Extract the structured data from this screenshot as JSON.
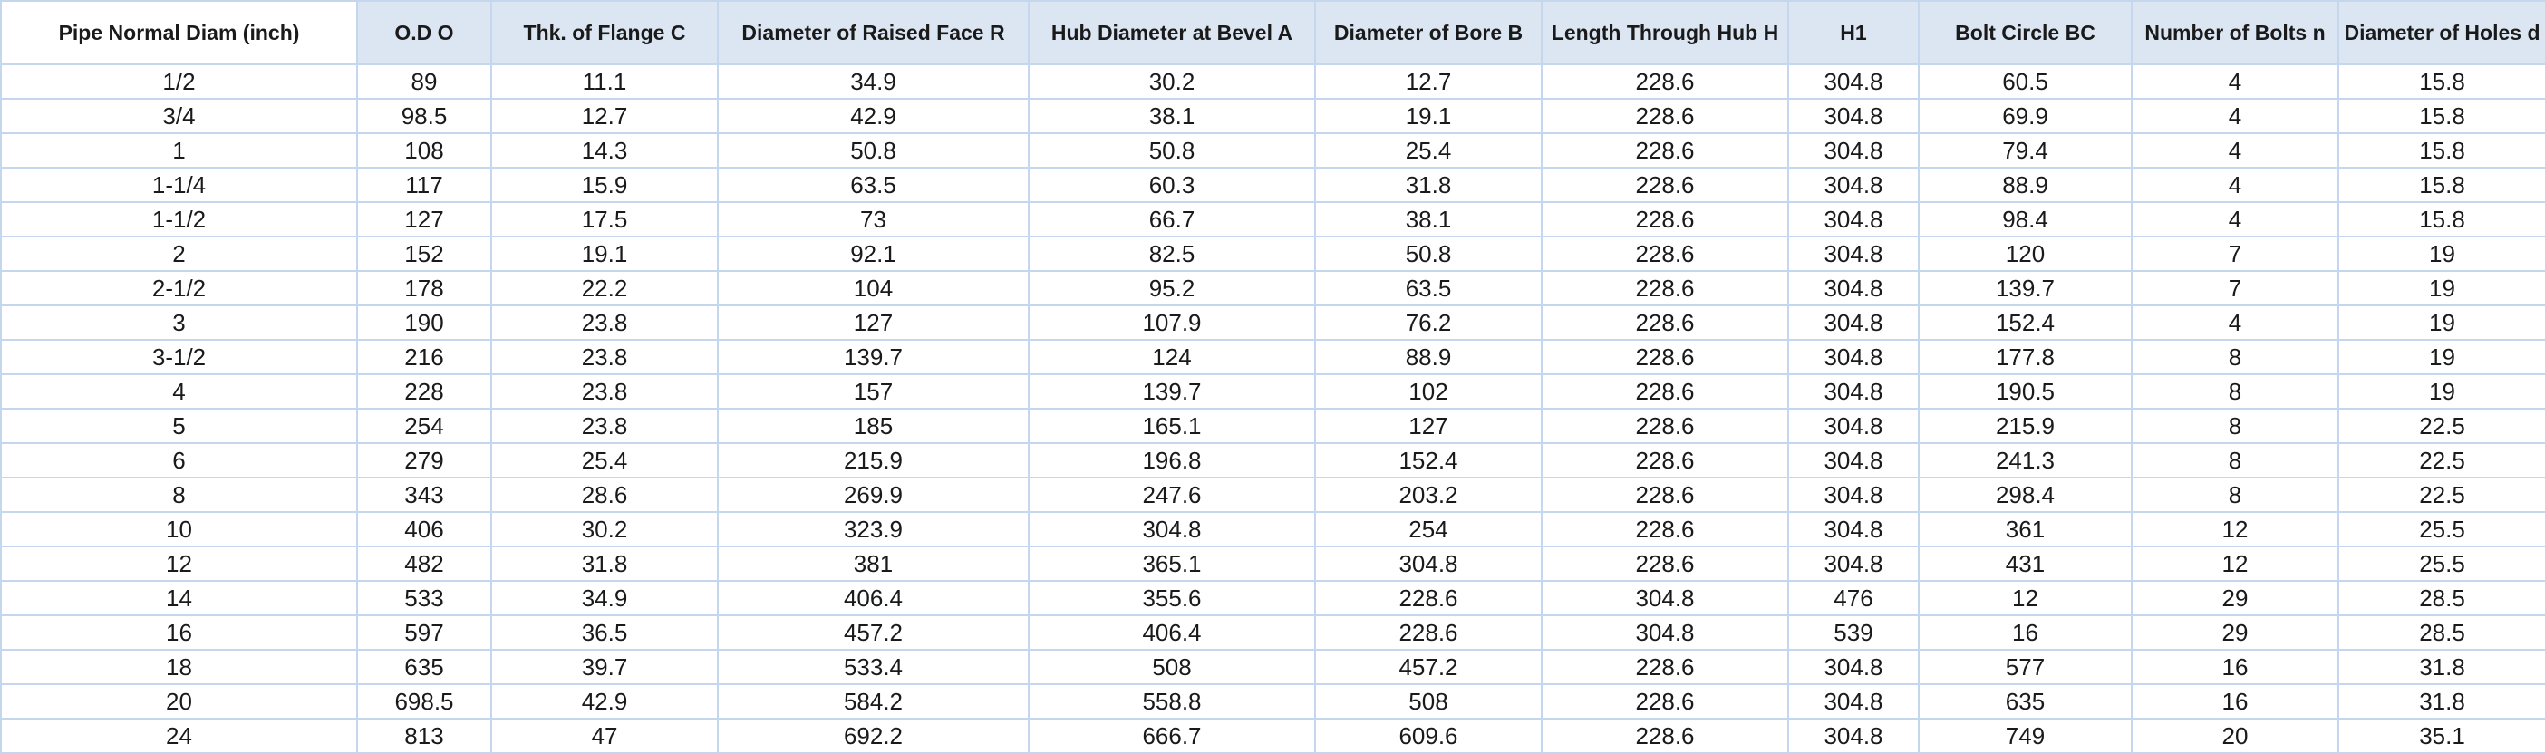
{
  "table": {
    "columns": [
      "Pipe Normal Diam (inch)",
      "O.D O",
      "Thk. of Flange C",
      "Diameter of Raised Face R",
      "Hub Diameter at Bevel A",
      "Diameter of Bore B",
      "Length Through Hub H",
      "H1",
      "Bolt Circle BC",
      "Number of Bolts n",
      "Diameter of Holes d"
    ],
    "rows": [
      [
        "1/2",
        "89",
        "11.1",
        "34.9",
        "30.2",
        "12.7",
        "228.6",
        "304.8",
        "60.5",
        "4",
        "15.8"
      ],
      [
        "3/4",
        "98.5",
        "12.7",
        "42.9",
        "38.1",
        "19.1",
        "228.6",
        "304.8",
        "69.9",
        "4",
        "15.8"
      ],
      [
        "1",
        "108",
        "14.3",
        "50.8",
        "50.8",
        "25.4",
        "228.6",
        "304.8",
        "79.4",
        "4",
        "15.8"
      ],
      [
        "1-1/4",
        "117",
        "15.9",
        "63.5",
        "60.3",
        "31.8",
        "228.6",
        "304.8",
        "88.9",
        "4",
        "15.8"
      ],
      [
        "1-1/2",
        "127",
        "17.5",
        "73",
        "66.7",
        "38.1",
        "228.6",
        "304.8",
        "98.4",
        "4",
        "15.8"
      ],
      [
        "2",
        "152",
        "19.1",
        "92.1",
        "82.5",
        "50.8",
        "228.6",
        "304.8",
        "120",
        "7",
        "19"
      ],
      [
        "2-1/2",
        "178",
        "22.2",
        "104",
        "95.2",
        "63.5",
        "228.6",
        "304.8",
        "139.7",
        "7",
        "19"
      ],
      [
        "3",
        "190",
        "23.8",
        "127",
        "107.9",
        "76.2",
        "228.6",
        "304.8",
        "152.4",
        "4",
        "19"
      ],
      [
        "3-1/2",
        "216",
        "23.8",
        "139.7",
        "124",
        "88.9",
        "228.6",
        "304.8",
        "177.8",
        "8",
        "19"
      ],
      [
        "4",
        "228",
        "23.8",
        "157",
        "139.7",
        "102",
        "228.6",
        "304.8",
        "190.5",
        "8",
        "19"
      ],
      [
        "5",
        "254",
        "23.8",
        "185",
        "165.1",
        "127",
        "228.6",
        "304.8",
        "215.9",
        "8",
        "22.5"
      ],
      [
        "6",
        "279",
        "25.4",
        "215.9",
        "196.8",
        "152.4",
        "228.6",
        "304.8",
        "241.3",
        "8",
        "22.5"
      ],
      [
        "8",
        "343",
        "28.6",
        "269.9",
        "247.6",
        "203.2",
        "228.6",
        "304.8",
        "298.4",
        "8",
        "22.5"
      ],
      [
        "10",
        "406",
        "30.2",
        "323.9",
        "304.8",
        "254",
        "228.6",
        "304.8",
        "361",
        "12",
        "25.5"
      ],
      [
        "12",
        "482",
        "31.8",
        "381",
        "365.1",
        "304.8",
        "228.6",
        "304.8",
        "431",
        "12",
        "25.5"
      ],
      [
        "14",
        "533",
        "34.9",
        "406.4",
        "355.6",
        "228.6",
        "304.8",
        "476",
        "12",
        "29",
        "28.5"
      ],
      [
        "16",
        "597",
        "36.5",
        "457.2",
        "406.4",
        "228.6",
        "304.8",
        "539",
        "16",
        "29",
        "28.5"
      ],
      [
        "18",
        "635",
        "39.7",
        "533.4",
        "508",
        "457.2",
        "228.6",
        "304.8",
        "577",
        "16",
        "31.8"
      ],
      [
        "20",
        "698.5",
        "42.9",
        "584.2",
        "558.8",
        "508",
        "228.6",
        "304.8",
        "635",
        "16",
        "31.8"
      ],
      [
        "24",
        "813",
        "47",
        "692.2",
        "666.7",
        "609.6",
        "228.6",
        "304.8",
        "749",
        "20",
        "35.1"
      ]
    ]
  },
  "colors": {
    "header_background": "#dce6f2",
    "grid_line": "#c5d7ee"
  }
}
